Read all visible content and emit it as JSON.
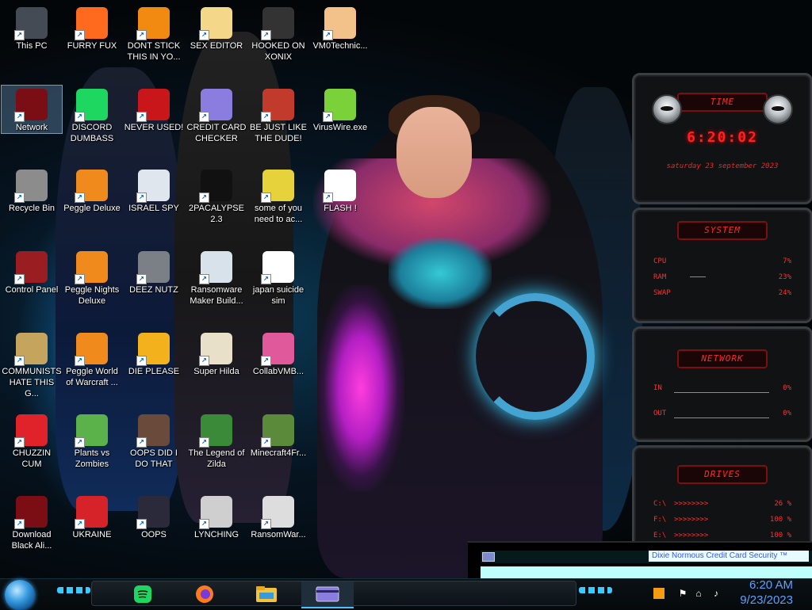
{
  "desktop_icons": [
    {
      "label": "This PC",
      "icon": "this-pc-icon",
      "color": "#444b55"
    },
    {
      "label": "FURRY FUX",
      "icon": "firefox-icon",
      "color": "#ff6a1f"
    },
    {
      "label": "DONT STICK THIS IN YO...",
      "icon": "vlc-cone-icon",
      "color": "#f28a12"
    },
    {
      "label": "SEX EDITOR",
      "icon": "anime-face-icon",
      "color": "#f5d78a"
    },
    {
      "label": "HOOKED ON XONIX",
      "icon": "xonix-icon",
      "color": "#333333"
    },
    {
      "label": "VM0Technic...",
      "icon": "doctor-icon",
      "color": "#f3c28a"
    },
    {
      "label": "Network",
      "icon": "alienware-network-icon",
      "color": "#7a0e14"
    },
    {
      "label": "DISCORD DUMBASS",
      "icon": "spotify-icon",
      "color": "#1ed760"
    },
    {
      "label": "NEVER USED!",
      "icon": "dev-cpp-icon",
      "color": "#c9161a"
    },
    {
      "label": "CREDIT CARD CHECKER",
      "icon": "credit-card-icon",
      "color": "#8b7de0"
    },
    {
      "label": "BE JUST LIKE THE DUDE!",
      "icon": "santa-icon",
      "color": "#c23a2c"
    },
    {
      "label": "VirusWire.exe",
      "icon": "limewire-icon",
      "color": "#7ad13a"
    },
    {
      "label": "Recycle Bin",
      "icon": "recycle-bin-icon",
      "color": "#8c8c8c"
    },
    {
      "label": "Peggle Deluxe",
      "icon": "peggle-icon",
      "color": "#f08a1c"
    },
    {
      "label": "ISRAEL SPY",
      "icon": "spy-folder-icon",
      "color": "#dfe6ee"
    },
    {
      "label": "2PACALYPSE 2.3",
      "icon": "terminal-icon",
      "color": "#111111"
    },
    {
      "label": "some of you need to ac...",
      "icon": "beaver-icon",
      "color": "#e6d23a"
    },
    {
      "label": "FLASH !",
      "icon": "flash-file-icon",
      "color": "#ffffff"
    },
    {
      "label": "Control Panel",
      "icon": "control-panel-icon",
      "color": "#9a1d22"
    },
    {
      "label": "Peggle Nights Deluxe",
      "icon": "peggle-nights-icon",
      "color": "#f08a1c"
    },
    {
      "label": "DEEZ NUTZ",
      "icon": "window-stack-icon",
      "color": "#7b8087"
    },
    {
      "label": "Ransomware Maker Build...",
      "icon": "installer-icon",
      "color": "#d8e2ea"
    },
    {
      "label": "japan suicide sim",
      "icon": "file-icon",
      "color": "#ffffff"
    },
    {
      "label": "COMMUNISTS HATE THIS G...",
      "icon": "money-bag-icon",
      "color": "#c5a45e"
    },
    {
      "label": "Peggle World of Warcraft ...",
      "icon": "peggle-wow-icon",
      "color": "#f08a1c"
    },
    {
      "label": "DIE PLEASE",
      "icon": "de-icon",
      "color": "#f3b21b"
    },
    {
      "label": "Super Hilda",
      "icon": "pixel-dog-icon",
      "color": "#e8e0c8"
    },
    {
      "label": "CollabVMB...",
      "icon": "monitor-icon",
      "color": "#e05a9b"
    },
    {
      "label": "CHUZZIN CUM",
      "icon": "chuzzle-icon",
      "color": "#e0232a"
    },
    {
      "label": "Plants vs Zombies",
      "icon": "plant-icon",
      "color": "#5bb24a"
    },
    {
      "label": "OOPS DID I DO THAT",
      "icon": "portrait-icon",
      "color": "#6a4a3a"
    },
    {
      "label": "The Legend of Zilda",
      "icon": "zelda-icon",
      "color": "#3a8a3a"
    },
    {
      "label": "Minecraft4Fr...",
      "icon": "grass-block-icon",
      "color": "#5a8a3a"
    },
    {
      "label": "Download Black Ali...",
      "icon": "alienware-download-icon",
      "color": "#7a0e14"
    },
    {
      "label": "UKRAINE",
      "icon": "radiation-icon",
      "color": "#d6232a"
    },
    {
      "label": "OOPS",
      "icon": "oops-icon",
      "color": "#2a2a3a"
    },
    {
      "label": "LYNCHING",
      "icon": "rope-icon",
      "color": "#cfcfcf"
    },
    {
      "label": "RansomWar...",
      "icon": "skull-icon",
      "color": "#dddddd"
    }
  ],
  "widgets": {
    "time": {
      "title": "TIME",
      "clock": "6:20:02",
      "date": "saturday 23 september 2023"
    },
    "system": {
      "title": "SYSTEM",
      "rows": [
        {
          "key": "CPU",
          "value": "7%"
        },
        {
          "key": "RAM",
          "value": "23%"
        },
        {
          "key": "SWAP",
          "value": "24%"
        }
      ]
    },
    "network": {
      "title": "NETWORK",
      "rows": [
        {
          "key": "IN",
          "value": "0%"
        },
        {
          "key": "OUT",
          "value": "0%"
        }
      ]
    },
    "drives": {
      "title": "DRIVES",
      "rows": [
        {
          "key": "C:\\",
          "value": "26 %",
          "arrows": ">>>>>>>>"
        },
        {
          "key": "F:\\",
          "value": "100 %",
          "arrows": ">>>>>>>>"
        },
        {
          "key": "E:\\",
          "value": "100 %",
          "arrows": ">>>>>>>>"
        }
      ]
    }
  },
  "app_window": {
    "marquee": "Dixie Normous Credit Card Security ™"
  },
  "taskbar": {
    "apps": [
      {
        "name": "spotify-icon",
        "active": false
      },
      {
        "name": "firefox-icon",
        "active": false
      },
      {
        "name": "file-explorer-icon",
        "active": false
      },
      {
        "name": "credit-card-icon",
        "active": true
      }
    ],
    "time": "6:20 AM",
    "date": "9/23/2023"
  },
  "colors": {
    "accent": "#ff2020",
    "clock_text": "#5ea0ff",
    "wall_title": "#2bb7e6"
  }
}
